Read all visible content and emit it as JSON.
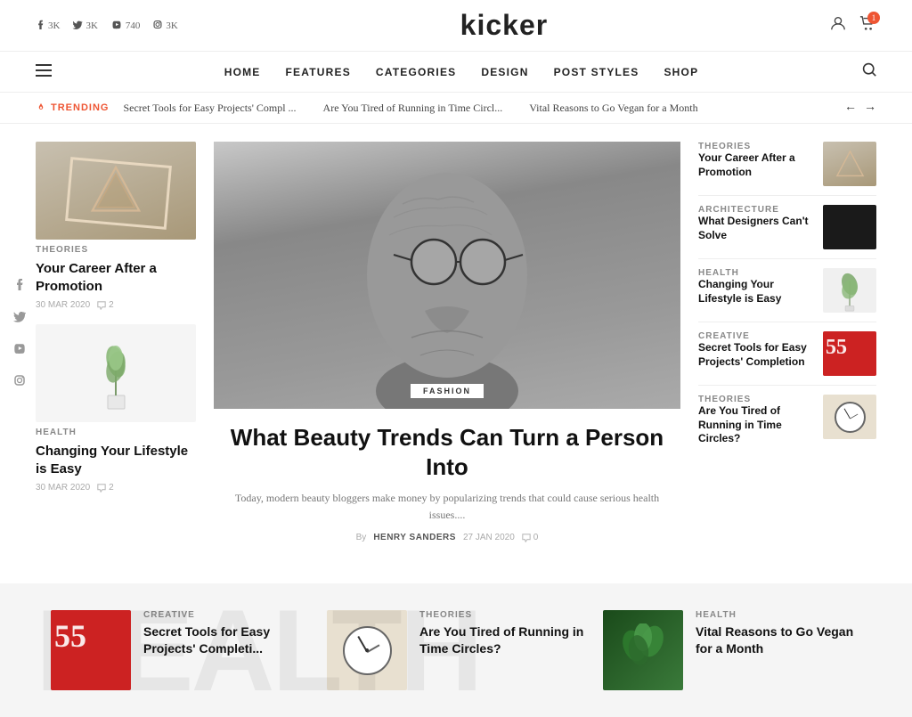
{
  "site": {
    "title": "kicker"
  },
  "topbar": {
    "social": [
      {
        "icon": "f",
        "count": "3K",
        "name": "facebook"
      },
      {
        "icon": "t",
        "count": "3K",
        "name": "twitter"
      },
      {
        "icon": "▶",
        "count": "740",
        "name": "youtube"
      },
      {
        "icon": "◻",
        "count": "3K",
        "name": "instagram"
      }
    ]
  },
  "nav": {
    "links": [
      {
        "label": "HOME"
      },
      {
        "label": "FEATURES"
      },
      {
        "label": "CATEGORIES"
      },
      {
        "label": "DESIGN"
      },
      {
        "label": "POST STYLES"
      },
      {
        "label": "SHOP"
      }
    ]
  },
  "trending": {
    "label": "TRENDING",
    "items": [
      "Secret Tools for Easy Projects' Compl ...",
      "Are You Tired of Running in Time Circl...",
      "Vital Reasons to Go Vegan for a Month"
    ]
  },
  "left_articles": [
    {
      "category": "THEORIES",
      "title": "Your Career After a Promotion",
      "date": "30 MAR 2020",
      "comments": "2",
      "thumb": "triangle"
    },
    {
      "category": "HEALTH",
      "title": "Changing Your Lifestyle is Easy",
      "date": "30 MAR 2020",
      "comments": "2",
      "thumb": "plant"
    }
  ],
  "hero": {
    "category": "FASHION",
    "title": "What Beauty Trends Can Turn a Person Into",
    "excerpt": "Today, modern beauty bloggers make money by popularizing trends that could cause serious health issues....",
    "author": "HENRY SANDERS",
    "date": "27 JAN 2020",
    "comments": "0"
  },
  "right_articles": [
    {
      "category": "THEORIES",
      "title": "Your Career After a Promotion",
      "thumb": "triangle"
    },
    {
      "category": "ARCHITECTURE",
      "title": "What Designers Can't Solve",
      "thumb": "dark"
    },
    {
      "category": "HEALTH",
      "title": "Changing Your Lifestyle is Easy",
      "thumb": "plant"
    },
    {
      "category": "CREATIVE",
      "title": "Secret Tools for Easy Projects' Completion",
      "thumb": "red"
    },
    {
      "category": "THEORIES",
      "title": "Are You Tired of Running in Time Circles?",
      "thumb": "clock"
    }
  ],
  "bottom_cards": [
    {
      "category": "CREATIVE",
      "title": "Secret Tools for Easy Projects' Completi...",
      "thumb": "red"
    },
    {
      "category": "THEORIES",
      "title": "Are You Tired of Running in Time Circles?",
      "thumb": "clock"
    },
    {
      "category": "HEALTH",
      "title": "Vital Reasons to Go Vegan for a Month",
      "thumb": "green"
    }
  ],
  "floating_social": [
    {
      "icon": "f",
      "name": "facebook"
    },
    {
      "icon": "t",
      "name": "twitter"
    },
    {
      "icon": "▶",
      "name": "youtube"
    },
    {
      "icon": "◻",
      "name": "instagram"
    }
  ],
  "icons": {
    "search": "🔍",
    "user": "👤",
    "cart": "🛒",
    "cart_count": "1",
    "menu": "☰",
    "fire": "🔥",
    "arrow_left": "←",
    "arrow_right": "→",
    "comment": "💬"
  }
}
